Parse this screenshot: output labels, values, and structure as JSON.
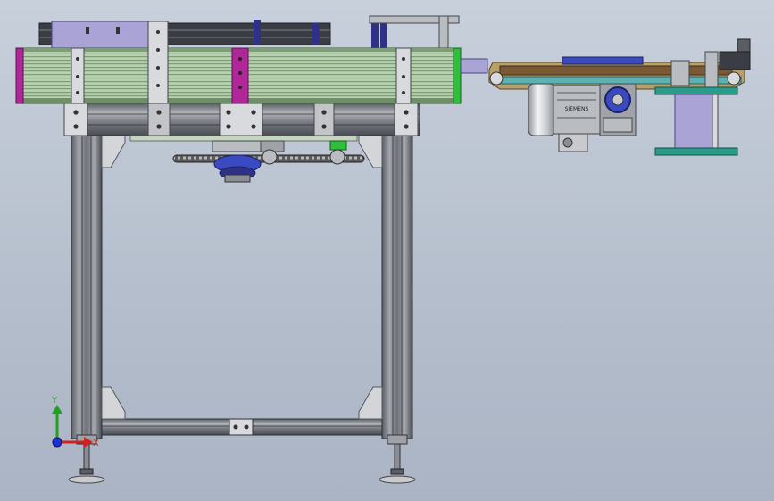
{
  "viewport": {
    "background_top": "#c8d0dc",
    "background_bottom": "#aab4c4"
  },
  "colors": {
    "frame_gray": "#8a8d93",
    "frame_dark": "#3b3d44",
    "rail_green": "#a9c7a2",
    "rail_green_dark": "#5f7f5b",
    "bracket_silver": "#d8dadd",
    "magenta_plate": "#b0279a",
    "lavender": "#a9a3d6",
    "navy": "#2e3185",
    "bright_green": "#2fbf3a",
    "teal": "#2b9c8a",
    "tan": "#b7a06a",
    "brown": "#7a5a34",
    "blue_gear": "#3a4ac0",
    "chain": "#444444"
  },
  "motor": {
    "label": "SIEMENS"
  },
  "triad": {
    "x_label": "X",
    "y_label": "Y",
    "x_color": "#d22020",
    "y_color": "#22a022",
    "z_color": "#2030d0",
    "icon": "coordinate-triad-icon"
  }
}
